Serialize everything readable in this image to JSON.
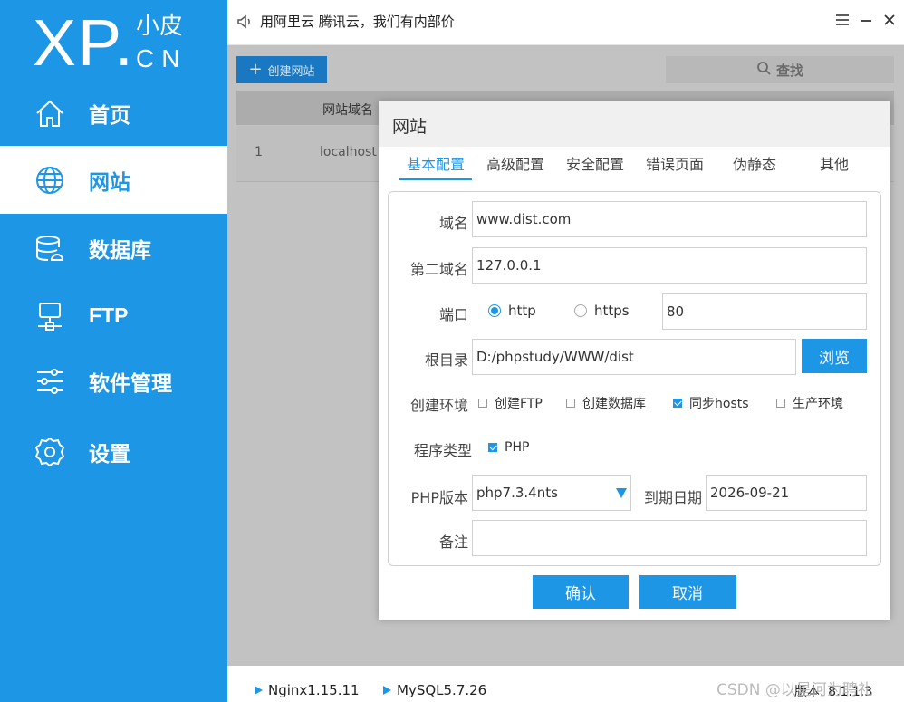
{
  "sidebar": {
    "logo_main": "XP.",
    "logo_small": "小皮",
    "logo_suffix": "CN",
    "items": [
      {
        "label": "首页",
        "icon": "home-icon"
      },
      {
        "label": "网站",
        "icon": "globe-icon",
        "active": true
      },
      {
        "label": "数据库",
        "icon": "database-icon"
      },
      {
        "label": "FTP",
        "icon": "ftp-icon"
      },
      {
        "label": "软件管理",
        "icon": "sliders-icon"
      },
      {
        "label": "设置",
        "icon": "gear-icon"
      }
    ]
  },
  "topbar": {
    "notice": "用阿里云 腾讯云，我们有内部价",
    "menu_icon": "menu-icon",
    "minimize_icon": "minimize-icon",
    "close_icon": "close-icon"
  },
  "main": {
    "create_button": "创建网站",
    "search_label": "查找",
    "table": {
      "headers": [
        "网站域名"
      ],
      "rows": [
        {
          "index": "1",
          "domain": "localhost"
        }
      ]
    }
  },
  "dialog": {
    "title": "网站",
    "tabs": [
      "基本配置",
      "高级配置",
      "安全配置",
      "错误页面",
      "伪静态",
      "其他"
    ],
    "active_tab": "基本配置",
    "domain_label": "域名",
    "domain_value": "www.dist.com",
    "second_domain_label": "第二域名",
    "second_domain_value": "127.0.0.1",
    "port_label": "端口",
    "protocol_http": "http",
    "protocol_https": "https",
    "protocol_selected": "http",
    "port_value": "80",
    "root_label": "根目录",
    "root_value": "D:/phpstudy/WWW/dist",
    "browse_button": "浏览",
    "env_label": "创建环境",
    "env_options": [
      {
        "label": "创建FTP",
        "checked": false
      },
      {
        "label": "创建数据库",
        "checked": false
      },
      {
        "label": "同步hosts",
        "checked": true
      },
      {
        "label": "生产环境",
        "checked": false
      }
    ],
    "program_label": "程序类型",
    "program_option": {
      "label": "PHP",
      "checked": true
    },
    "php_label": "PHP版本",
    "php_value": "php7.3.4nts",
    "expire_label": "到期日期",
    "expire_value": "2026-09-21",
    "note_label": "备注",
    "note_value": "",
    "confirm_button": "确认",
    "cancel_button": "取消"
  },
  "statusbar": {
    "services": [
      "Nginx1.15.11",
      "MySQL5.7.26"
    ],
    "version_label": "版本",
    "version_value": "8.1.1.3",
    "watermark": "CSDN @以星河为聘礼"
  },
  "colors": {
    "accent": "#1e96e6",
    "sidebar_bg": "#1e96e6",
    "overlay": "#c2c2c2"
  }
}
